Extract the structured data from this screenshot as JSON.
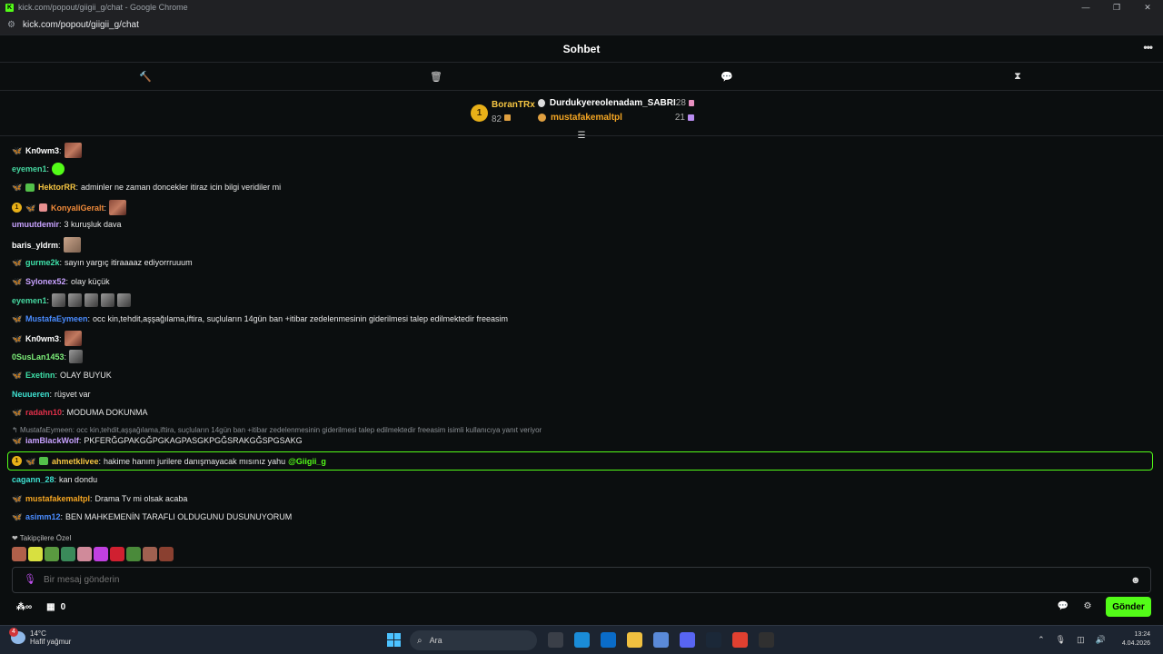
{
  "browser": {
    "window_title": "kick.com/popout/giigii_g/chat - Google Chrome",
    "url": "kick.com/popout/giigii_g/chat",
    "favicon_letter": "K",
    "controls": [
      "—",
      "❐",
      "✕"
    ]
  },
  "chat": {
    "title": "Sohbet",
    "more_label": "•••",
    "toolbar_icons": [
      "hammer-icon",
      "trash-icon",
      "chat-bubble-icon",
      "hourglass-icon"
    ],
    "leaderboard": {
      "first": {
        "rank": "1",
        "name": "BoranTRx",
        "points": "82"
      },
      "others": [
        {
          "name": "Durdukyereolenadam_SABRI",
          "points": "28",
          "color": "#ffffff"
        },
        {
          "name": "mustafakemaltpl",
          "points": "21",
          "color": "#f5a623"
        }
      ]
    },
    "messages": [
      {
        "user": "Kn0wm3",
        "color": "#ffffff",
        "text": ""
      },
      {
        "user": "eyemen1",
        "color": "#46d7a0",
        "text": ""
      },
      {
        "user": "HektorRR",
        "color": "#f5c542",
        "text": "adminler ne zaman doncekler itiraz icin bilgi veridiler mi"
      },
      {
        "user": "KonyaliGeralt",
        "color": "#f08a3a",
        "text": ""
      },
      {
        "user": "umuutdemir",
        "color": "#c8a2ff",
        "text": "3 kuruşluk dava"
      },
      {
        "user": "baris_yldrm",
        "color": "#ffffff",
        "text": ""
      },
      {
        "user": "gurme2k",
        "color": "#3ee0a8",
        "text": "sayın yargıç itiraaaaz ediyorrruuum"
      },
      {
        "user": "Sylonex52",
        "color": "#c8a2ff",
        "text": "olay küçük"
      },
      {
        "user": "eyemen1",
        "color": "#46d7a0",
        "text": ""
      },
      {
        "user": "MustafaEymeen",
        "color": "#4a8cff",
        "text": "occ kin,tehdit,aşşağılama,iftira, suçluların 14gün ban +itibar zedelenmesinin giderilmesi talep edilmektedir freeasim"
      },
      {
        "user": "Kn0wm3",
        "color": "#ffffff",
        "text": ""
      },
      {
        "user": "0SusLan1453",
        "color": "#7df07a",
        "text": ""
      },
      {
        "user": "Exetinn",
        "color": "#3ee0a8",
        "text": "OLAY BUYUK"
      },
      {
        "user": "Neuueren",
        "color": "#3ee0d0",
        "text": "rüşvet var"
      },
      {
        "user": "radahn10",
        "color": "#e0304a",
        "text": "MODUMA DOKUNMA"
      },
      {
        "user": "iamBlackWolf",
        "color": "#c8a2ff",
        "text": "PKFERĞGPAKGĞPGKAGPASGKPGĞSRAKGĞSPGSAKG"
      },
      {
        "user": "ahmetklivee",
        "color": "#f5c542",
        "text": "hakime hanım jurilere danışmayacak mısınız yahu"
      },
      {
        "user": "cagann_28",
        "color": "#3ee0d0",
        "text": "kan dondu"
      },
      {
        "user": "mustafakemaltpl",
        "color": "#f5a623",
        "text": "Drama Tv mi olsak acaba"
      },
      {
        "user": "asimm12",
        "color": "#4a8cff",
        "text": "BEN MAHKEMENİN TARAFLI OLDUGUNU DUSUNUYORUM"
      }
    ],
    "reply_context": "MustafaEymeen: occ kin,tehdit,aşşağılama,iftira, suçluların 14gün ban +itibar zedelenmesinin giderilmesi talep edilmektedir freeasim isimli kullanıcıya yanıt veriyor",
    "mention": "@Giigii_g",
    "followers_only_label": "Takipçilere Özel",
    "input_placeholder": "Bir mesaj gönderin",
    "points_count": "0",
    "send_label": "Gönder",
    "accent_color": "#53fc18"
  },
  "taskbar": {
    "weather_temp": "14°C",
    "weather_desc": "Hafif yağmur",
    "weather_badge": "4",
    "search_placeholder": "Ara",
    "time": "13:24",
    "date": "4.04.2026"
  }
}
